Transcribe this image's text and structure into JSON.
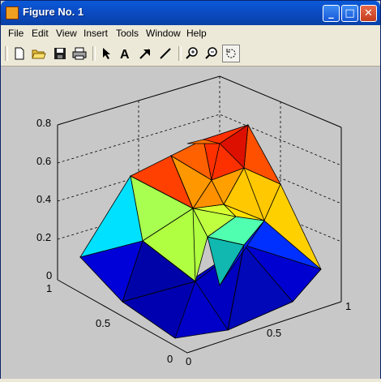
{
  "window": {
    "title": "Figure No. 1"
  },
  "menu": [
    "File",
    "Edit",
    "View",
    "Insert",
    "Tools",
    "Window",
    "Help"
  ],
  "toolbar": [
    "new-file-icon",
    "open-folder-icon",
    "save-icon",
    "print-icon",
    "select-arrow-icon",
    "text-a-icon",
    "arrow-tool-icon",
    "line-tool-icon",
    "zoom-in-icon",
    "zoom-out-icon",
    "rotate-3d-icon"
  ],
  "plot": {
    "z_ticks": [
      "0",
      "0.2",
      "0.4",
      "0.6",
      "0.8"
    ],
    "y_ticks": [
      "0",
      "0.5",
      "1"
    ],
    "x_ticks": [
      "0",
      "0.5",
      "1"
    ]
  },
  "colors": {
    "canvas": "#c8c8c8",
    "title_bar": "#0b4bc4"
  }
}
